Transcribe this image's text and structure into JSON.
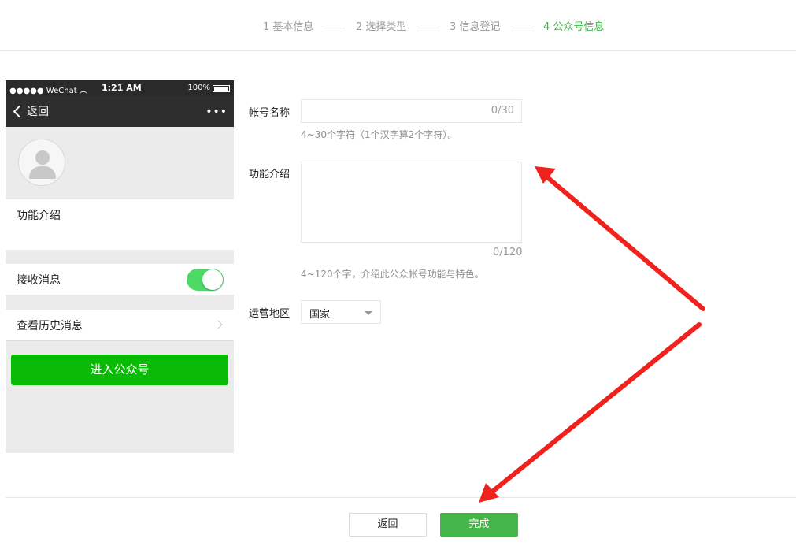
{
  "steps": [
    {
      "label": "1 基本信息",
      "active": false
    },
    {
      "label": "2 选择类型",
      "active": false
    },
    {
      "label": "3 信息登记",
      "active": false
    },
    {
      "label": "4 公众号信息",
      "active": true
    }
  ],
  "phone": {
    "status_left": "●●●●● WeChat",
    "time": "1:21 AM",
    "battery": "100%",
    "back_label": "返回",
    "more": "•••",
    "intro_label": "功能介绍",
    "receive_label": "接收消息",
    "receive_on": true,
    "history_label": "查看历史消息",
    "enter_button": "进入公众号"
  },
  "form": {
    "name_label": "帐号名称",
    "name_value": "",
    "name_counter": "0/30",
    "name_hint": "4~30个字符（1个汉字算2个字符）。",
    "intro_label": "功能介绍",
    "intro_value": "",
    "intro_counter": "0/120",
    "intro_hint": "4~120个字，介绍此公众帐号功能与特色。",
    "region_label": "运营地区",
    "region_value": "国家"
  },
  "footer": {
    "back_label": "返回",
    "done_label": "完成"
  },
  "colors": {
    "accent": "#44b549",
    "wechat_green": "#09bb07",
    "arrow_red": "#f0221d"
  }
}
